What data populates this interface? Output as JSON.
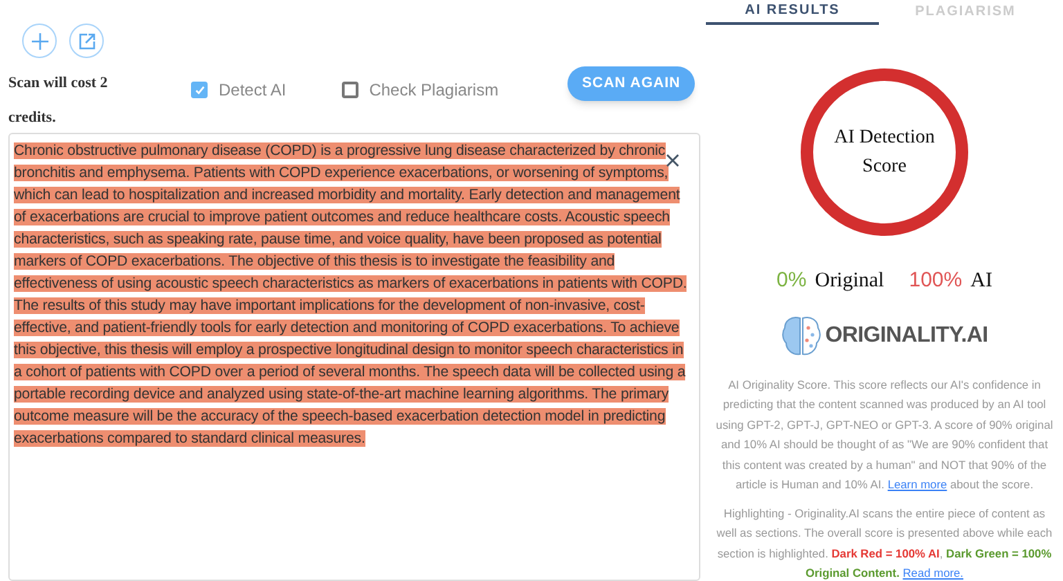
{
  "toolbar": {
    "buttons": [
      {
        "kind": "add"
      },
      {
        "kind": "export"
      }
    ]
  },
  "cost_note": "Scan will cost 2 credits.",
  "options": [
    {
      "label": "Detect AI",
      "checked": true
    },
    {
      "label": "Check Plagiarism",
      "checked": false
    }
  ],
  "scan_button": "SCAN AGAIN",
  "editor": {
    "highlighted": true,
    "text": "Chronic obstructive pulmonary disease (COPD) is a progressive lung disease characterized by chronic bronchitis and emphysema. Patients with COPD experience exacerbations, or worsening of symptoms, which can lead to hospitalization and increased morbidity and mortality. Early detection and management of exacerbations are crucial to improve patient outcomes and reduce healthcare costs. Acoustic speech characteristics, such as speaking rate, pause time, and voice quality, have been proposed as potential markers of COPD exacerbations. The objective of this thesis is to investigate the feasibility and effectiveness of using acoustic speech characteristics as markers of exacerbations in patients with COPD. The results of this study may have important implications for the development of non-invasive, cost-effective, and patient-friendly tools for early detection and monitoring of COPD exacerbations. To achieve this objective, this thesis will employ a prospective longitudinal design to monitor speech characteristics in a cohort of patients with COPD over a period of several months. The speech data will be collected using a portable recording device and analyzed using state-of-the-art machine learning algorithms. The primary outcome measure will be the accuracy of the speech-based exacerbation detection model in predicting exacerbations compared to standard clinical measures."
  },
  "tabs": [
    {
      "label": "AI RESULTS",
      "selected": true
    },
    {
      "label": "PLAGIARISM",
      "selected": false
    }
  ],
  "score": {
    "title": "AI Detection Score",
    "level": 1,
    "original_pct": "0%",
    "original_label": "Original",
    "ai_pct": "100%",
    "ai_label": "AI"
  },
  "logo": "ORIGINALITY.AI",
  "score_info": [
    {
      "kind": "text",
      "text": "AI Originality Score. This score reflects our AI's confidence in predicting that the content scanned was produced by an AI tool using GPT-2, GPT-J, GPT-NEO or GPT-3. A score of 90% original and 10% AI should be thought of as \"We are 90% confident that this content was created by a human\" and NOT that 90% of the article is Human and 10% AI. "
    },
    {
      "kind": "link",
      "text": "Learn more"
    },
    {
      "kind": "text",
      "text": " about the score."
    }
  ],
  "highlight_info": [
    {
      "kind": "text",
      "text": "Highlighting - Originality.AI scans the entire piece of content as well as sections. The overall score is presented above while each section is highlighted. "
    },
    {
      "kind": "ai",
      "text": "Dark Red = 100% AI"
    },
    {
      "kind": "text",
      "text": ", "
    },
    {
      "kind": "original",
      "text": "Dark Green = 100% Original Content. "
    },
    {
      "kind": "link",
      "text": "Read more."
    }
  ]
}
